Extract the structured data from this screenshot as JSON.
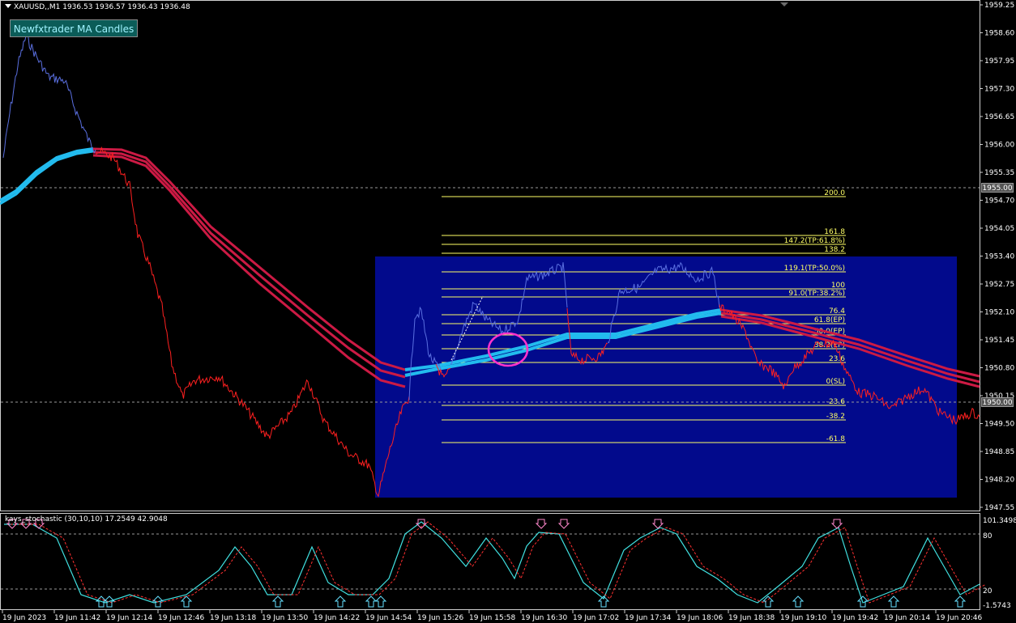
{
  "window": {
    "title": "XAUUSD,,M1  1936.53 1936.57 1936.43 1936.48"
  },
  "button": {
    "label": "Newfxtrader MA Candles"
  },
  "indicator": {
    "label": "kays_stochastic (30,10,10) 17.2549 42.9048",
    "scale_labels": [
      "101.3498",
      "80",
      "20",
      "-1.5743"
    ]
  },
  "price_axis": {
    "labels": [
      "1959.25",
      "1958.60",
      "1957.95",
      "1957.30",
      "1956.65",
      "1956.00",
      "1955.35",
      "1954.70",
      "1954.05",
      "1953.40",
      "1952.75",
      "1952.10",
      "1951.45",
      "1950.80",
      "1950.15",
      "1949.50",
      "1948.85",
      "1948.20",
      "1947.55"
    ],
    "highlight_1": "1955.00",
    "highlight_2": "1950.00"
  },
  "time_axis": {
    "labels": [
      "19 Jun 2023",
      "19 Jun 11:42",
      "19 Jun 12:14",
      "19 Jun 12:46",
      "19 Jun 13:18",
      "19 Jun 13:50",
      "19 Jun 14:22",
      "19 Jun 14:54",
      "19 Jun 15:26",
      "19 Jun 15:58",
      "19 Jun 16:30",
      "19 Jun 17:02",
      "19 Jun 17:34",
      "19 Jun 18:06",
      "19 Jun 18:38",
      "19 Jun 19:10",
      "19 Jun 19:42",
      "19 Jun 20:14",
      "19 Jun 20:46"
    ]
  },
  "fibonacci": {
    "levels": [
      "200.0",
      "161.8",
      "147.2(TP:61.8%)",
      "138.2",
      "119.1(TP:50.0%)",
      "100",
      "91.0(TP:38.2%)",
      "76.4",
      "61.8(EP)",
      "50.0(EP)",
      "38.2(EP)",
      "23.6",
      "0(SL)",
      "-23.6",
      "-38.2",
      "-61.8"
    ]
  },
  "colors": {
    "background": "#000000",
    "up_line": "#5a6fe0",
    "down_line": "#ff2020",
    "ma_up": "#22bbee",
    "ma_down": "#cc1a44",
    "fib_zone": "#020a8c",
    "fib_line": "#ffff66",
    "stoch_main": "#40e0e0",
    "stoch_signal": "#ff3030",
    "circle": "#ff33cc"
  },
  "icons": [
    "buy-arrow-icon",
    "sell-arrow-icon",
    "dropdown-triangle-icon"
  ]
}
